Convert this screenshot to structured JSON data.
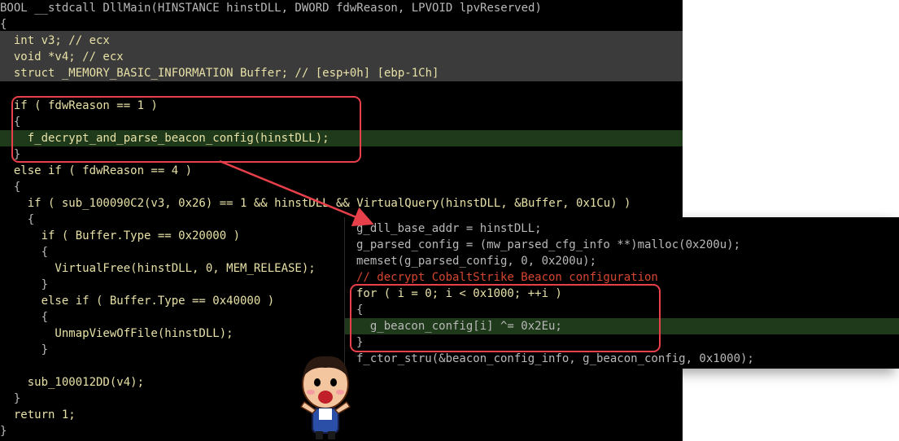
{
  "left_code": {
    "l1": "BOOL __stdcall DllMain(HINSTANCE hinstDLL, DWORD fdwReason, LPVOID lpvReserved)",
    "l2": "{",
    "l3": "  int v3; // ecx",
    "l4": "  void *v4; // ecx",
    "l5": "  struct _MEMORY_BASIC_INFORMATION Buffer; // [esp+0h] [ebp-1Ch]",
    "l6": "",
    "l7": "  if ( fdwReason == 1 )",
    "l8": "  {",
    "l9": "    f_decrypt_and_parse_beacon_config(hinstDLL);",
    "l10": "  }",
    "l11": "  else if ( fdwReason == 4 )",
    "l12": "  {",
    "l13": "    if ( sub_100090C2(v3, 0x26) == 1 && hinstDLL && VirtualQuery(hinstDLL, &Buffer, 0x1Cu) )",
    "l14": "    {",
    "l15": "      if ( Buffer.Type == 0x20000 )",
    "l16": "      {",
    "l17": "        VirtualFree(hinstDLL, 0, MEM_RELEASE);",
    "l18": "      }",
    "l19": "      else if ( Buffer.Type == 0x40000 )",
    "l20": "      {",
    "l21": "        UnmapViewOfFile(hinstDLL);",
    "l22": "      }",
    "l23": "    sub_100012DD(v4);",
    "l24": "  }",
    "l25": "  return 1;",
    "l26": "}"
  },
  "right_code": {
    "r1": "g_dll_base_addr = hinstDLL;",
    "r2": "g_parsed_config = (mw_parsed_cfg_info **)malloc(0x200u);",
    "r3": "memset(g_parsed_config, 0, 0x200u);",
    "r4": "// decrypt CobaltStrike Beacon configuration",
    "r5": "for ( i = 0; i < 0x1000; ++i )",
    "r6": "{",
    "r7": "  g_beacon_config[i] ^= 0x2Eu;",
    "r8": "}",
    "r9": "f_ctor_stru(&beacon_config_info, g_beacon_config, 0x1000);"
  },
  "colors": {
    "background": "#000000",
    "annotation_box": "#e8404a",
    "line_highlight_gray": "#3b3b3b",
    "line_highlight_green": "#1f3a1a"
  },
  "icons": {
    "arrow": "annotation-arrow",
    "mascot": "cartoon-mascot"
  }
}
